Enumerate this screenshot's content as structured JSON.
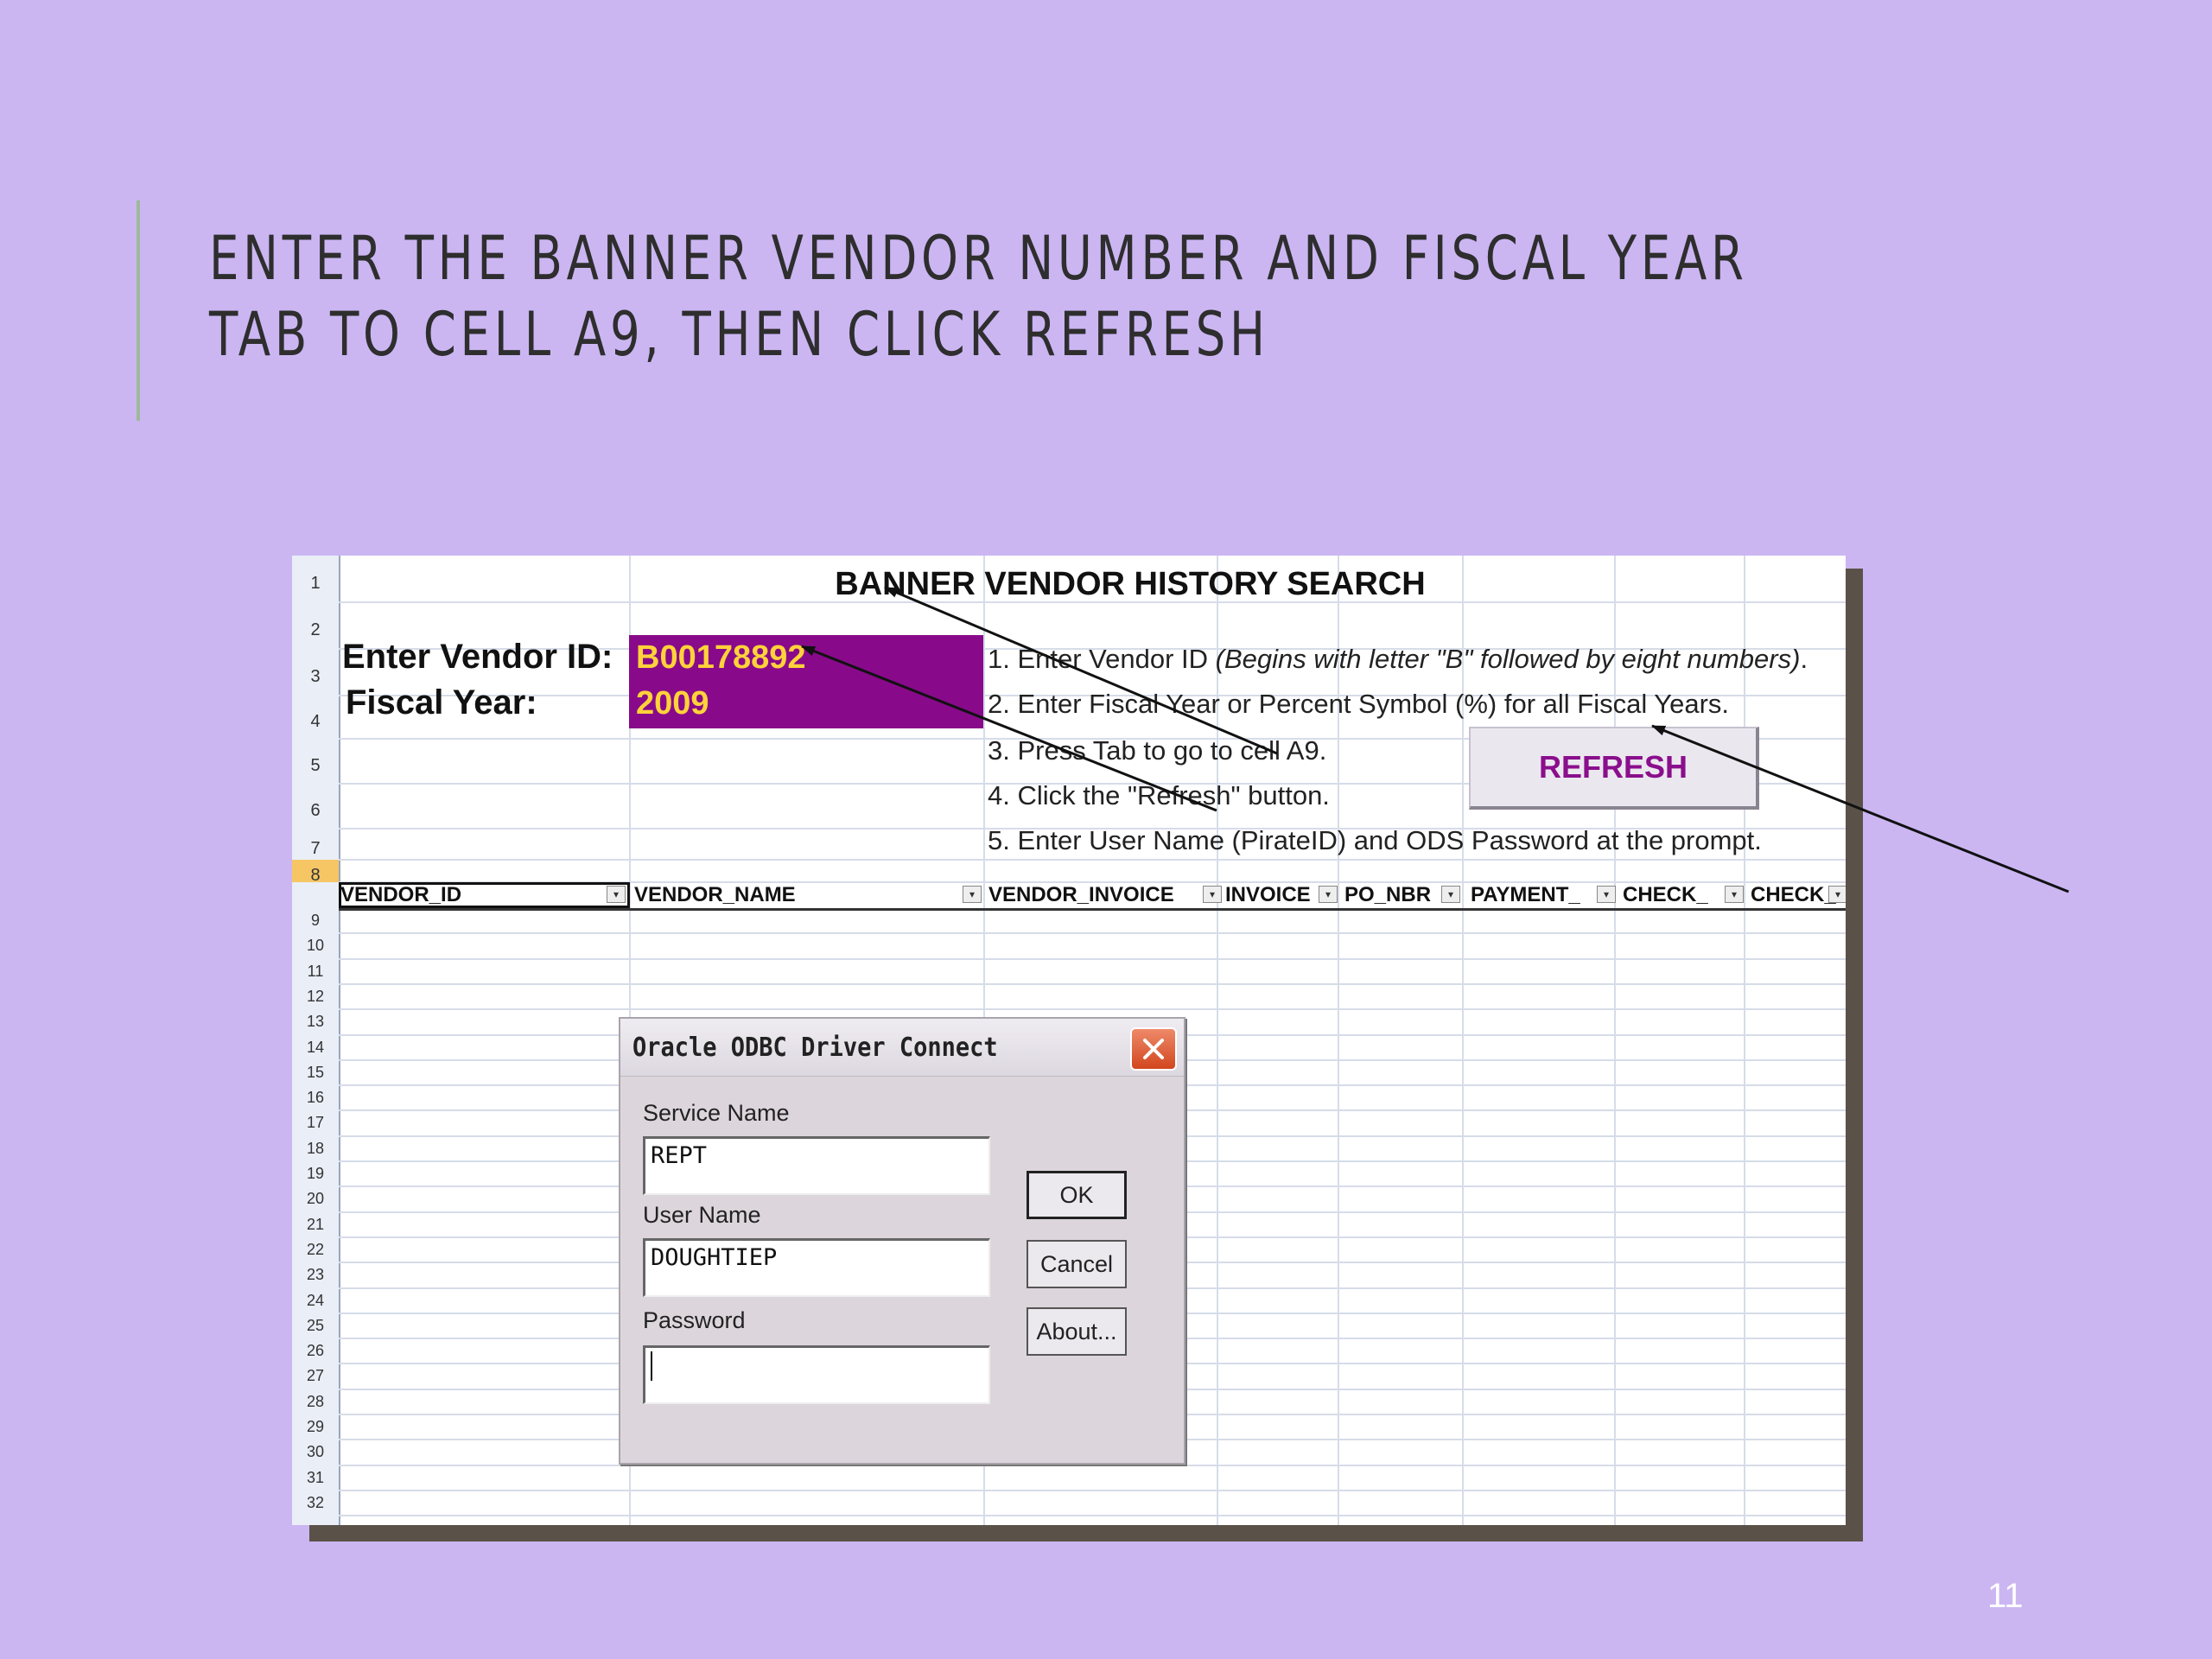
{
  "slide": {
    "title_line1": "Enter the Banner vendor number and fiscal year",
    "title_line2": "Tab to cell A9, then click refresh",
    "number": "11"
  },
  "sheet": {
    "title": "BANNER VENDOR HISTORY SEARCH",
    "vendor_label": "Enter Vendor ID:",
    "vendor_value": "B00178892",
    "fiscal_label": "Fiscal Year:",
    "fiscal_value": "2009",
    "instructions": {
      "i1": "1. Enter Vendor ID",
      "i1_note": "(Begins with letter \"B\" followed by eight numbers)",
      "i2": "2. Enter Fiscal Year or Percent Symbol (%)  for all Fiscal Years.",
      "i3": "3. Press Tab to go to cell A9.",
      "i4": "4. Click the \"Refresh\" button.",
      "i5": "5. Enter User Name (PirateID) and ODS Password at the prompt."
    },
    "refresh_label": "REFRESH",
    "columns": [
      "VENDOR_ID",
      "VENDOR_NAME",
      "VENDOR_INVOICE",
      "INVOICE",
      "PO_NBR",
      "PAYMENT_",
      "CHECK_",
      "CHECK_"
    ],
    "dropdown_glyph": "▾",
    "rows": [
      "1",
      "2",
      "3",
      "4",
      "5",
      "6",
      "7",
      "8",
      "9",
      "10",
      "11",
      "12",
      "13",
      "14",
      "15",
      "16",
      "17",
      "18",
      "19",
      "20",
      "21",
      "22",
      "23",
      "24",
      "25",
      "26",
      "27",
      "28",
      "29",
      "30",
      "31",
      "32"
    ],
    "active_row": "8",
    "colors": {
      "cell_fill": "#880a8a",
      "cell_text": "#ffd23a",
      "refresh_text": "#8a0f8c",
      "active_row_header": "#f6c665"
    }
  },
  "dialog": {
    "title": "Oracle ODBC Driver Connect",
    "service_label": "Service Name",
    "service_value": "REPT",
    "user_label": "User Name",
    "user_value": "DOUGHTIEP",
    "password_label": "Password",
    "password_value": "",
    "ok_label": "OK",
    "cancel_label": "Cancel",
    "about_label": "About..."
  }
}
